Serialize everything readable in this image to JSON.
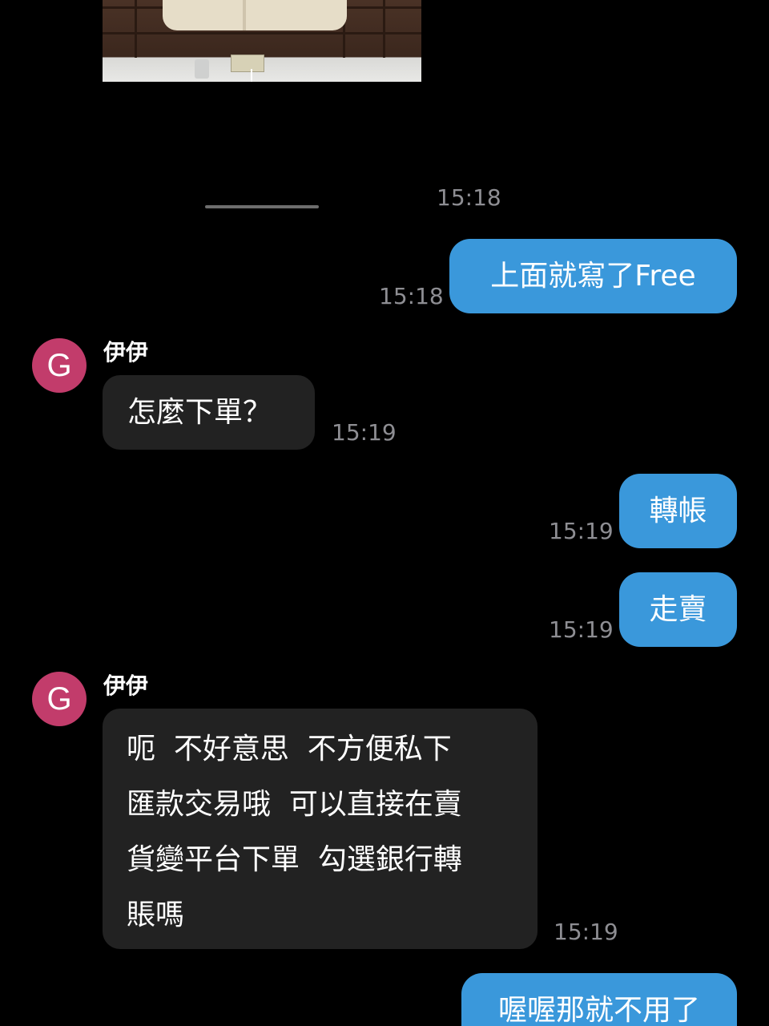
{
  "messages": {
    "photo_time": "15:18",
    "m1": {
      "text": "上面就寫了Free",
      "time": "15:18"
    },
    "m2": {
      "sender": "伊伊",
      "avatar": "G",
      "text": "怎麼下單？",
      "time": "15:19"
    },
    "m3": {
      "text": "轉帳",
      "time": "15:19"
    },
    "m4": {
      "text": "走賣",
      "time": "15:19"
    },
    "m5": {
      "sender": "伊伊",
      "avatar": "G",
      "text": "呃  不好意思  不方便私下\n匯款交易哦  可以直接在賣\n貨變平台下單  勾選銀行轉\n賬嗎",
      "time": "15:19"
    },
    "m6": {
      "text": "喔喔那就不用了"
    }
  },
  "colors": {
    "background": "#000000",
    "outgoing_bubble": "#3a98db",
    "incoming_bubble": "#222222",
    "avatar": "#c23c6b",
    "timestamp": "#8e8e93"
  }
}
